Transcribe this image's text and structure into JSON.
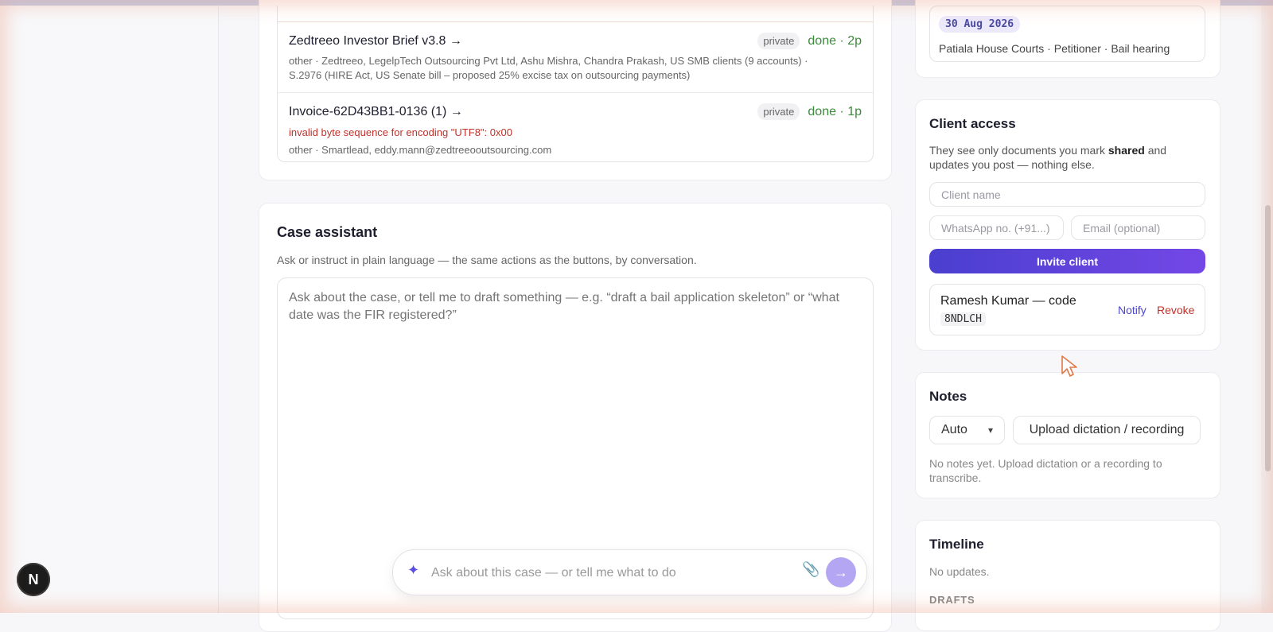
{
  "documents": [
    {
      "title": "Zedtreeo Investor Brief v3.8 →",
      "visibility": "private",
      "status": "done · 2p",
      "meta": "other · Zedtreeo, LegelpTech Outsourcing Pvt Ltd, Ashu Mishra, Chandra Prakash, US SMB clients (9 accounts) · S.2976 (HIRE Act, US Senate bill – proposed 25% excise tax on outsourcing payments)"
    },
    {
      "title": "Invoice-62D43BB1-0136 (1) →",
      "visibility": "private",
      "status": "done · 1p",
      "error": "invalid byte sequence for encoding \"UTF8\": 0x00",
      "meta": "other · Smartlead, eddy.mann@zedtreeooutsourcing.com"
    }
  ],
  "case_assistant": {
    "title": "Case assistant",
    "subtitle": "Ask or instruct in plain language — the same actions as the buttons, by conversation.",
    "textarea_placeholder": "Ask about the case, or tell me to draft something — e.g. “draft a bail application skeleton” or “what date was the FIR registered?”",
    "chat_placeholder": "Ask about this case — or tell me what to do"
  },
  "hearing": {
    "date": "30 Aug 2026",
    "details": "Patiala House Courts · Petitioner · Bail hearing"
  },
  "client_access": {
    "title": "Client access",
    "desc_before": "They see only documents you mark ",
    "desc_bold": "shared",
    "desc_after": " and updates you post — nothing else.",
    "name_placeholder": "Client name",
    "whatsapp_placeholder": "WhatsApp no. (+91...)",
    "email_placeholder": "Email (optional)",
    "invite_label": "Invite client",
    "client": {
      "name": "Ramesh Kumar — code",
      "code": "8NDLCH",
      "notify": "Notify",
      "revoke": "Revoke"
    }
  },
  "notes": {
    "title": "Notes",
    "mode": "Auto",
    "upload_label": "Upload dictation / recording",
    "empty": "No notes yet. Upload dictation or a recording to transcribe."
  },
  "timeline": {
    "title": "Timeline",
    "empty": "No updates.",
    "drafts_label": "DRAFTS"
  },
  "badge": "N",
  "icons": {
    "sparkle": "sparkle-icon",
    "attach": "paperclip-icon",
    "send": "arrow-right-icon",
    "chevron": "chevron-down-icon",
    "cursor": "mouse-cursor-icon"
  },
  "colors": {
    "accent": "#4a3fcf",
    "status_done": "#3c8a3c",
    "error": "#c0322a"
  }
}
